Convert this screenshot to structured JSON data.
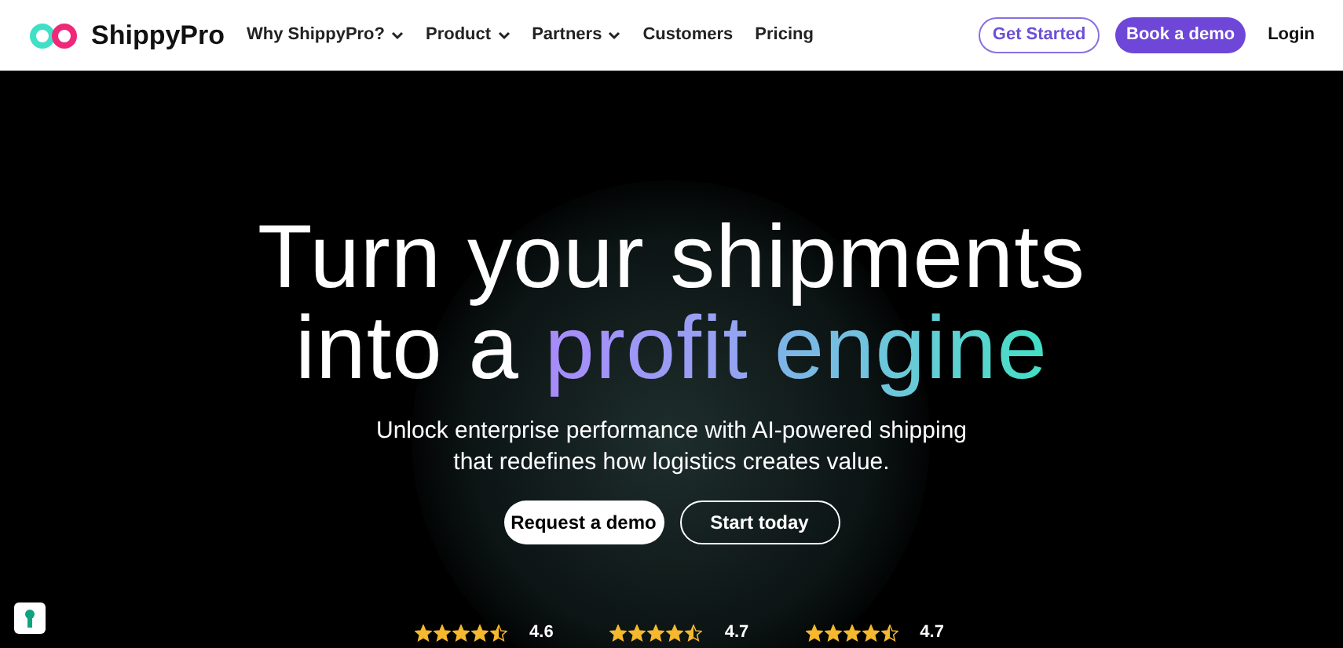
{
  "brand": {
    "name": "ShippyPro"
  },
  "nav": [
    {
      "label": "Why ShippyPro?",
      "dropdown": true
    },
    {
      "label": "Product",
      "dropdown": true
    },
    {
      "label": "Partners",
      "dropdown": true
    },
    {
      "label": "Customers",
      "dropdown": false
    },
    {
      "label": "Pricing",
      "dropdown": false
    }
  ],
  "actions": {
    "get_started": "Get Started",
    "book_demo": "Book a demo",
    "login": "Login"
  },
  "hero": {
    "headline_line_1": "Turn your shipments",
    "headline_line_2": [
      "into a",
      "profit",
      "engine"
    ],
    "subtitle_line_1": "Unlock enterprise performance with AI-powered shipping",
    "subtitle_line_2": "that redefines how logistics creates value.",
    "buttons": [
      "Request a demo",
      "Start today"
    ]
  },
  "ratings": [
    {
      "stars": 4.5,
      "score": "4.6"
    },
    {
      "stars": 4.5,
      "score": "4.7"
    },
    {
      "stars": 4.5,
      "score": "4.7"
    }
  ]
}
